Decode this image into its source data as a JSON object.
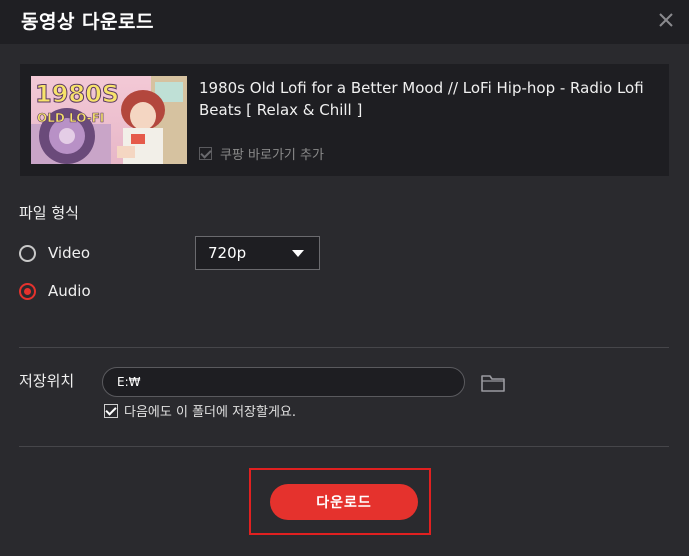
{
  "dialog": {
    "title": "동영상 다운로드"
  },
  "video": {
    "title": "1980s Old Lofi for a Better Mood // LoFi Hip-hop - Radio Lofi Beats  [ Relax & Chill ]",
    "thumbnail_text_line1": "1980S",
    "thumbnail_text_line2": "OLD LO-FI",
    "coupang_label": "쿠팡 바로가기 추가",
    "coupang_checked": true,
    "coupang_enabled": false
  },
  "format": {
    "label": "파일 형식",
    "options": [
      {
        "label": "Video",
        "selected": false
      },
      {
        "label": "Audio",
        "selected": true
      }
    ],
    "quality_value": "720p"
  },
  "save": {
    "label": "저장위치",
    "path": "E:₩",
    "remember_label": "다음에도 이 폴더에 저장할게요.",
    "remember_checked": true
  },
  "actions": {
    "download_label": "다운로드"
  },
  "colors": {
    "accent": "#e5322d",
    "background": "#2a2a2e",
    "titlebar": "#1f1f23"
  },
  "icons": {
    "close": "close-icon",
    "folder": "folder-icon",
    "dropdown": "chevron-down-icon"
  }
}
